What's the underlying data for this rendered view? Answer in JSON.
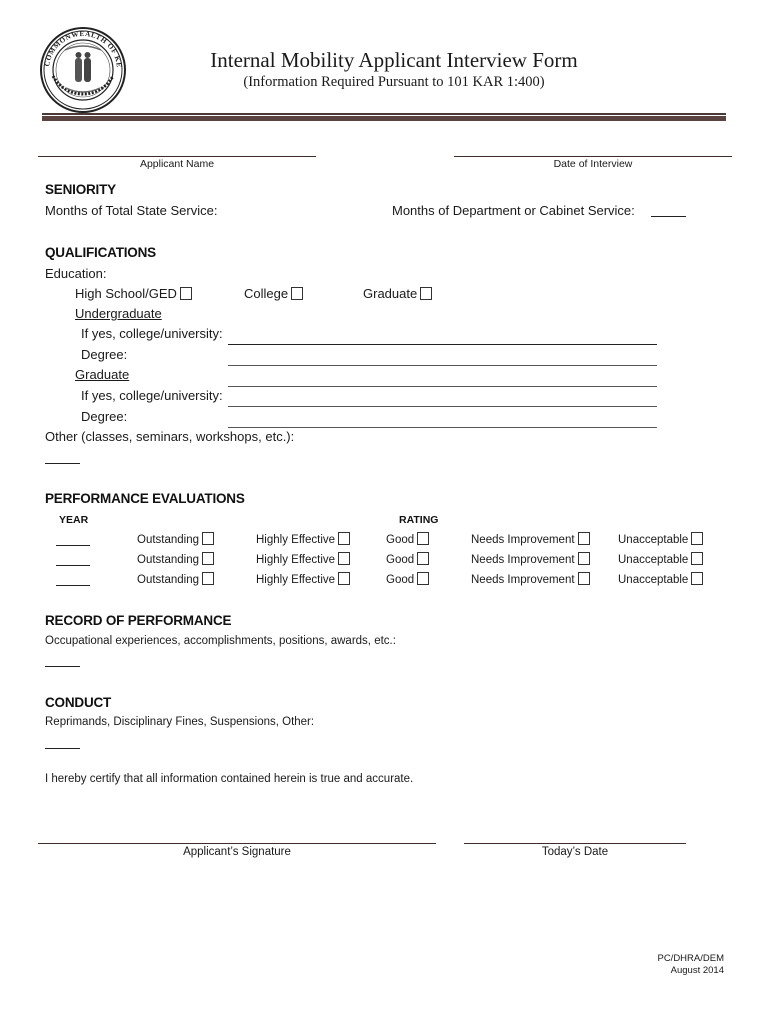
{
  "header": {
    "seal_text": "COMMONWEALTH OF KENTUCKY",
    "title": "Internal Mobility Applicant Interview Form",
    "subtitle": "(Information Required Pursuant to 101 KAR 1:400)"
  },
  "top_fields": {
    "applicant_name_label": "Applicant Name",
    "applicant_name_value": "",
    "date_of_interview_label": "Date of Interview",
    "date_of_interview_value": ""
  },
  "seniority": {
    "heading": "SENIORITY",
    "total_state_service_label": "Months of Total State Service:",
    "total_state_service_value": "",
    "department_service_label": "Months of Department or Cabinet Service:",
    "department_service_value": ""
  },
  "qualifications": {
    "heading": "QUALIFICATIONS",
    "education_label": "Education:",
    "options": [
      {
        "label": "High School/GED",
        "checked": false
      },
      {
        "label": "College",
        "checked": false
      },
      {
        "label": "Graduate",
        "checked": false
      }
    ],
    "undergraduate_heading": "Undergraduate",
    "undergraduate_university_label": "If yes, college/university:",
    "undergraduate_university_value": "",
    "undergraduate_degree_label": "Degree:",
    "undergraduate_degree_value": "",
    "graduate_heading": "Graduate",
    "graduate_university_label": "If yes, college/university:",
    "graduate_university_value": "",
    "graduate_degree_label": "Degree:",
    "graduate_degree_value": "",
    "other_label": "Other (classes, seminars, workshops, etc.):",
    "other_value": ""
  },
  "performance_evaluations": {
    "heading": "PERFORMANCE EVALUATIONS",
    "year_header": "YEAR",
    "rating_header": "RATING",
    "rating_options": [
      "Outstanding",
      "Highly Effective",
      "Good",
      "Needs Improvement",
      "Unacceptable"
    ],
    "rows": [
      {
        "year": "",
        "selected": null
      },
      {
        "year": "",
        "selected": null
      },
      {
        "year": "",
        "selected": null
      }
    ]
  },
  "record_of_performance": {
    "heading": "RECORD OF PERFORMANCE",
    "label": "Occupational experiences, accomplishments, positions, awards, etc.:",
    "value": ""
  },
  "conduct": {
    "heading": "CONDUCT",
    "label": "Reprimands, Disciplinary Fines, Suspensions, Other:",
    "value": ""
  },
  "certification": {
    "statement": "I hereby certify that all information contained herein is true and accurate.",
    "signature_label": "Applicant’s Signature",
    "todays_date_label": "Today’s Date"
  },
  "footer": {
    "code": "PC/DHRA/DEM",
    "date": "August 2014"
  }
}
